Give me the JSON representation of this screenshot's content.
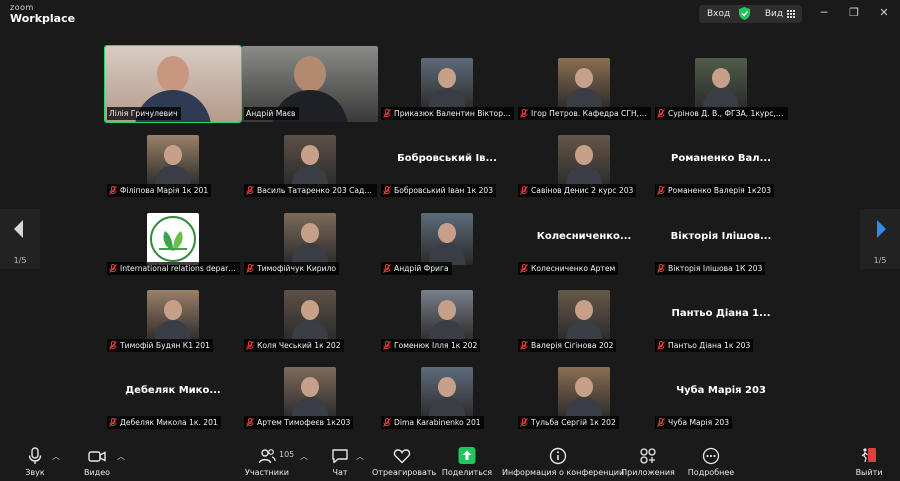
{
  "titlebar": {
    "logo_top": "zoom",
    "logo_bottom": "Workplace",
    "enter_label": "Вход",
    "view_label": "Вид"
  },
  "gallery": {
    "page_left": "1/5",
    "page_right": "1/5",
    "tiles": [
      {
        "name": "Лілія Гричулевич",
        "video": "face",
        "muted": false,
        "active": true
      },
      {
        "name": "Андрій Маєв",
        "video": "face",
        "muted": false
      },
      {
        "name": "Приказюк Валентин Вікторов...",
        "video": "small",
        "muted": true
      },
      {
        "name": "Ігор Петров. Кафедра СГН, ...",
        "video": "small",
        "muted": true
      },
      {
        "name": "Сурінов Д. В., ФГЗА, 1курс, G...",
        "video": "small",
        "muted": true
      },
      {
        "name": "Філіпова Марія 1к 201",
        "video": "small",
        "muted": true
      },
      {
        "name": "Василь Татаренко 203 Садов...",
        "video": "small",
        "muted": true
      },
      {
        "name": "Бобровський Іван 1к 203",
        "video": "text",
        "big": "Бобровський Ів...",
        "muted": true
      },
      {
        "name": "Савінов Денис 2 курс 203",
        "video": "small",
        "muted": true
      },
      {
        "name": "Романенко Валерія 1к203",
        "video": "text",
        "big": "Романенко Вал...",
        "muted": true
      },
      {
        "name": "International relations depart...",
        "video": "logo",
        "muted": true
      },
      {
        "name": "Тимофійчук Кирило",
        "video": "small",
        "muted": true
      },
      {
        "name": "Андрій Фрига",
        "video": "small",
        "muted": true
      },
      {
        "name": "Колесниченко Артем",
        "video": "text",
        "big": "Колесниченко...",
        "muted": true
      },
      {
        "name": "Вікторія Ілішова 1К 203",
        "video": "text",
        "big": "Вікторія Ілішов...",
        "muted": true
      },
      {
        "name": "Тимофій Будян К1 201",
        "video": "small",
        "muted": true
      },
      {
        "name": "Коля Чеський 1к 202",
        "video": "small",
        "muted": true
      },
      {
        "name": "Гоменюк Ілля 1к 202",
        "video": "small",
        "muted": true
      },
      {
        "name": "Валерія Сігінова 202",
        "video": "small",
        "muted": true
      },
      {
        "name": "Пантьо Діана 1к 203",
        "video": "text",
        "big": "Пантьо Діана 1...",
        "muted": true
      },
      {
        "name": "Дебеляк Микола 1к. 201",
        "video": "text",
        "big": "Дебеляк Мико...",
        "muted": true
      },
      {
        "name": "Артем Тимофеєв 1к203",
        "video": "small",
        "muted": true
      },
      {
        "name": "Dima Karabinenko 201",
        "video": "small",
        "muted": true
      },
      {
        "name": "Тульба Сергій 1к 202",
        "video": "small",
        "muted": true
      },
      {
        "name": "Чуба Марія  203",
        "video": "text",
        "big": "Чуба Марія  203",
        "muted": true
      }
    ]
  },
  "toolbar": {
    "audio": "Звук",
    "video": "Видео",
    "participants": "Участники",
    "participants_count": "105",
    "chat": "Чат",
    "react": "Отреагировать",
    "share": "Поделиться",
    "info": "Информация о конференции",
    "apps": "Приложения",
    "more": "Подробнее",
    "leave": "Выйти"
  },
  "colors": {
    "background": "#1a1a1a",
    "active_speaker": "#23d96b",
    "share_green": "#22c55e",
    "nav_arrow": "#2f8ce8",
    "mute_red": "#e0403a"
  }
}
